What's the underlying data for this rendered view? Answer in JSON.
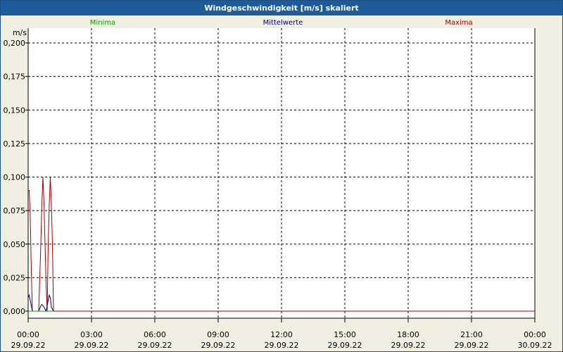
{
  "window": {
    "title": "Windgeschwindigkeit [m/s] skaliert"
  },
  "colors": {
    "minima": "#00a000",
    "mittelwerte": "#000080",
    "maxima": "#a00000",
    "titlebar": "#1e5b99",
    "background": "#f1efe2"
  },
  "chart_data": {
    "type": "line",
    "title": "Windgeschwindigkeit [m/s] skaliert",
    "ylabel": "m/s",
    "xlabel": "",
    "ylim": [
      0,
      0.2
    ],
    "xlim_hours": [
      0,
      24
    ],
    "yticks": [
      "0,000",
      "0,025",
      "0,050",
      "0,075",
      "0,100",
      "0,125",
      "0,150",
      "0,175",
      "0,200"
    ],
    "xticks": [
      {
        "time": "00:00",
        "date": "29.09.22"
      },
      {
        "time": "03:00",
        "date": "29.09.22"
      },
      {
        "time": "06:00",
        "date": "29.09.22"
      },
      {
        "time": "09:00",
        "date": "29.09.22"
      },
      {
        "time": "12:00",
        "date": "29.09.22"
      },
      {
        "time": "15:00",
        "date": "29.09.22"
      },
      {
        "time": "18:00",
        "date": "29.09.22"
      },
      {
        "time": "21:00",
        "date": "29.09.22"
      },
      {
        "time": "00:00",
        "date": "30.09.22"
      }
    ],
    "grid": true,
    "legend_position": "top",
    "series": [
      {
        "name": "Minima",
        "color": "#00a000",
        "points": [
          [
            0,
            0
          ],
          [
            24,
            0
          ]
        ]
      },
      {
        "name": "Mittelwerte",
        "color": "#000080",
        "points": [
          [
            0,
            0.01
          ],
          [
            0.05,
            0.012
          ],
          [
            0.1,
            0.008
          ],
          [
            0.2,
            0
          ],
          [
            0.5,
            0
          ],
          [
            0.6,
            0.004
          ],
          [
            0.65,
            0.005
          ],
          [
            0.75,
            0.003
          ],
          [
            0.85,
            0
          ],
          [
            0.95,
            0.008
          ],
          [
            1.0,
            0.012
          ],
          [
            1.05,
            0.01
          ],
          [
            1.1,
            0.003
          ],
          [
            1.2,
            0
          ],
          [
            24,
            0
          ]
        ]
      },
      {
        "name": "Maxima",
        "color": "#a00000",
        "points": [
          [
            0,
            0.09
          ],
          [
            0.05,
            0.09
          ],
          [
            0.1,
            0.07
          ],
          [
            0.15,
            0.03
          ],
          [
            0.2,
            0
          ],
          [
            0.5,
            0
          ],
          [
            0.6,
            0.05
          ],
          [
            0.65,
            0.08
          ],
          [
            0.7,
            0.1
          ],
          [
            0.75,
            0.08
          ],
          [
            0.85,
            0.02
          ],
          [
            0.9,
            0
          ],
          [
            0.95,
            0.05
          ],
          [
            1.0,
            0.08
          ],
          [
            1.05,
            0.1
          ],
          [
            1.1,
            0.08
          ],
          [
            1.15,
            0.05
          ],
          [
            1.2,
            0
          ],
          [
            24,
            0
          ]
        ]
      }
    ]
  }
}
